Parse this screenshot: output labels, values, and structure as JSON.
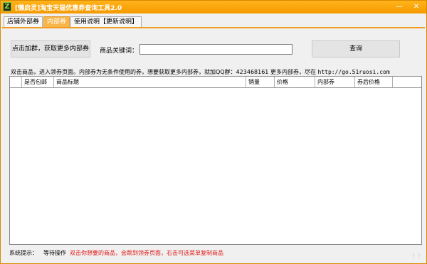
{
  "window": {
    "title": "[懒启灵]淘宝天猫优惠券查询工具2.0",
    "icon": "Z",
    "accent_color": "#f39b20"
  },
  "tabs": [
    {
      "label": "店铺外部券",
      "active": false
    },
    {
      "label": "内部券",
      "active": true
    },
    {
      "label": "使用说明【更新说明】",
      "active": false
    }
  ],
  "toolbar": {
    "join_button": "点击加群，获取更多内部券",
    "keyword_label": "商品关键词：",
    "keyword_value": "",
    "query_button": "查询"
  },
  "notice": {
    "text": "双击商品，进入领券页面。内部券为无条件使用的券，想要获取更多内部券，就加QQ群：423468161 更多内部券，尽在",
    "url": "http://go.51ruosi.com"
  },
  "table": {
    "columns": [
      "",
      "是否包邮",
      "商品标题",
      "销量",
      "价格",
      "内部券",
      "券后价格"
    ],
    "rows": []
  },
  "status": {
    "label": "系统提示：",
    "state": "等待操作",
    "hint": "双击你想要的商品，会跳到领券页面，右击可选菜单复制商品",
    "hint_color": "#e01818"
  }
}
